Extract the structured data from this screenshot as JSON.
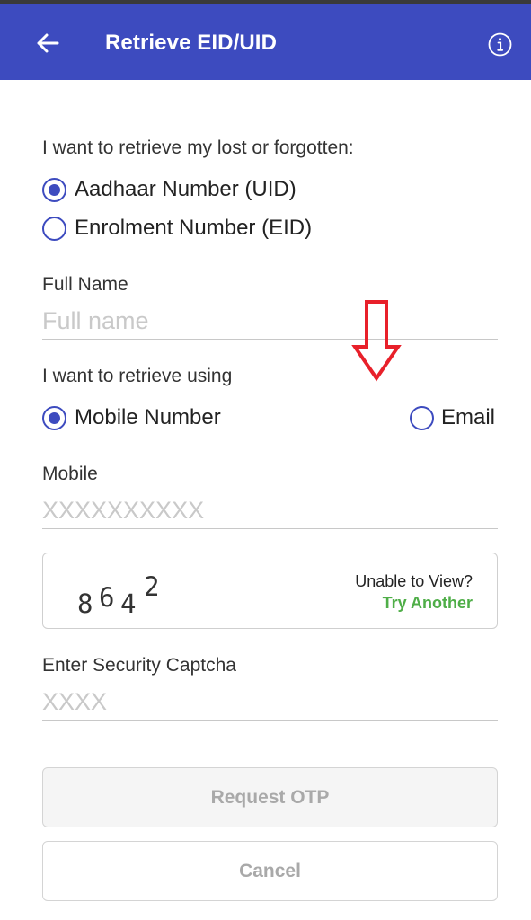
{
  "app_bar": {
    "title": "Retrieve EID/UID",
    "back_icon": "arrow-left-icon",
    "info_icon": "info-circle-icon",
    "background": "#3d4bbf"
  },
  "form": {
    "intro_label": "I want to retrieve my lost or forgotten:",
    "retrieve_type": {
      "options": [
        "Aadhaar Number (UID)",
        "Enrolment Number (EID)"
      ],
      "selected": "Aadhaar Number (UID)"
    },
    "full_name": {
      "label": "Full Name",
      "placeholder": "Full name",
      "value": ""
    },
    "method_label": "I want to retrieve using",
    "method": {
      "options": [
        "Mobile Number",
        "Email"
      ],
      "selected": "Mobile Number"
    },
    "mobile": {
      "label": "Mobile",
      "placeholder": "XXXXXXXXXX",
      "value": ""
    },
    "captcha": {
      "image_text": "8642",
      "unable_text": "Unable to View?",
      "try_another": "Try Another"
    },
    "security_captcha": {
      "label": "Enter Security Captcha",
      "placeholder": "XXXX",
      "value": ""
    },
    "buttons": {
      "request_otp": "Request OTP",
      "cancel": "Cancel"
    }
  },
  "colors": {
    "primary": "#3d4bbf",
    "link_green": "#4fae48",
    "annotation_red": "#e8202a",
    "disabled_text": "#a9a9a9"
  }
}
